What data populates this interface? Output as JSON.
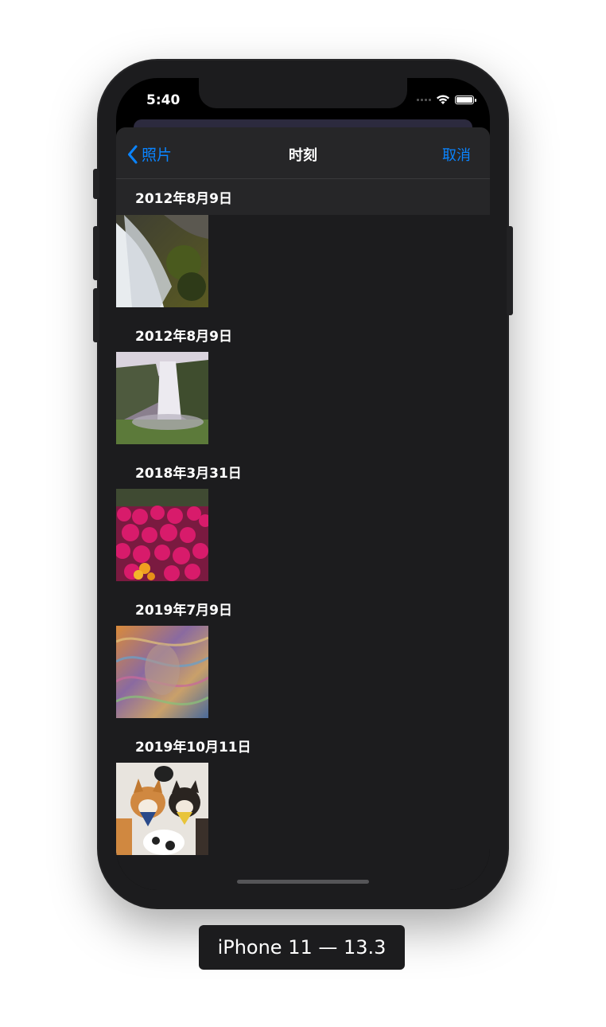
{
  "status_bar": {
    "time": "5:40"
  },
  "nav": {
    "back_label": "照片",
    "title": "时刻",
    "cancel_label": "取消"
  },
  "sections": [
    {
      "date": "2012年8月9日",
      "photo": "waterfall-rocks"
    },
    {
      "date": "2012年8月9日",
      "photo": "waterfall-cliff"
    },
    {
      "date": "2018年3月31日",
      "photo": "pink-flowers"
    },
    {
      "date": "2019年7月9日",
      "photo": "colorful-swirl"
    },
    {
      "date": "2019年10月11日",
      "photo": "corgi-dogs"
    }
  ],
  "device_caption": "iPhone 11 — 13.3",
  "colors": {
    "accent": "#0a84ff",
    "background": "#1c1c1e"
  }
}
